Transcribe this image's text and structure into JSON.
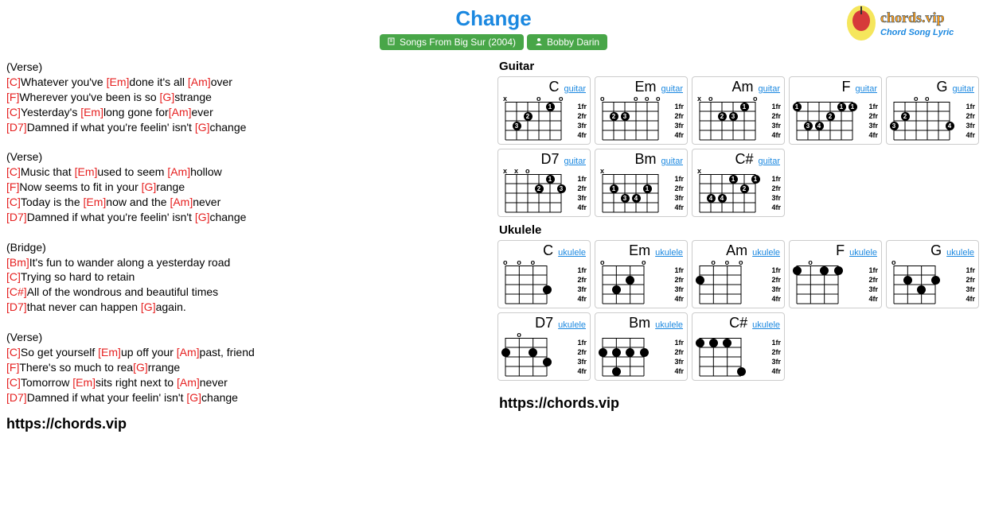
{
  "header": {
    "title": "Change",
    "album_tag": "Songs From Big Sur (2004)",
    "artist_tag": "Bobby Darin",
    "logo_main": "chords.vip",
    "logo_sub": "Chord Song Lyric"
  },
  "lyrics": [
    {
      "type": "text",
      "v": "(Verse)"
    },
    {
      "type": "line",
      "parts": [
        [
          "[C]",
          "Whatever you've "
        ],
        [
          "[Em]",
          "done it's all "
        ],
        [
          "[Am]",
          "over"
        ]
      ]
    },
    {
      "type": "line",
      "parts": [
        [
          "[F]",
          "Wherever you've been is so "
        ],
        [
          "[G]",
          "strange"
        ]
      ]
    },
    {
      "type": "line",
      "parts": [
        [
          "[C]",
          "Yesterday's "
        ],
        [
          "[Em]",
          "long gone for"
        ],
        [
          "[Am]",
          "ever"
        ]
      ]
    },
    {
      "type": "line",
      "parts": [
        [
          "[D7]",
          "Damned if what you're feelin' isn't "
        ],
        [
          "[G]",
          "change"
        ]
      ]
    },
    {
      "type": "blank"
    },
    {
      "type": "text",
      "v": "(Verse)"
    },
    {
      "type": "line",
      "parts": [
        [
          "[C]",
          "Music that "
        ],
        [
          "[Em]",
          "used to seem "
        ],
        [
          "[Am]",
          "hollow"
        ]
      ]
    },
    {
      "type": "line",
      "parts": [
        [
          "[F]",
          "Now seems to fit in your "
        ],
        [
          "[G]",
          "range"
        ]
      ]
    },
    {
      "type": "line",
      "parts": [
        [
          "[C]",
          "Today is the "
        ],
        [
          "[Em]",
          "now and the "
        ],
        [
          "[Am]",
          "never"
        ]
      ]
    },
    {
      "type": "line",
      "parts": [
        [
          "[D7]",
          "Damned if what you're feelin' isn't "
        ],
        [
          "[G]",
          "change"
        ]
      ]
    },
    {
      "type": "blank"
    },
    {
      "type": "text",
      "v": "(Bridge)"
    },
    {
      "type": "line",
      "parts": [
        [
          "[Bm]",
          "It's fun to wander along a yesterday road"
        ]
      ]
    },
    {
      "type": "line",
      "parts": [
        [
          "[C]",
          "Trying so hard to retain"
        ]
      ]
    },
    {
      "type": "line",
      "parts": [
        [
          "[C#]",
          "All of the wondrous and beautiful times"
        ]
      ]
    },
    {
      "type": "line",
      "parts": [
        [
          "[D7]",
          "that never can happen "
        ],
        [
          "[G]",
          "again."
        ]
      ]
    },
    {
      "type": "blank"
    },
    {
      "type": "text",
      "v": "(Verse)"
    },
    {
      "type": "line",
      "parts": [
        [
          "[C]",
          "So get yourself "
        ],
        [
          "[Em]",
          "up off your "
        ],
        [
          "[Am]",
          "past, friend"
        ]
      ]
    },
    {
      "type": "line",
      "parts": [
        [
          "[F]",
          "There's so much to rea"
        ],
        [
          "[G]",
          "rrange"
        ]
      ]
    },
    {
      "type": "line",
      "parts": [
        [
          "[C]",
          "Tomorrow "
        ],
        [
          "[Em]",
          "sits right next to "
        ],
        [
          "[Am]",
          "never"
        ]
      ]
    },
    {
      "type": "line",
      "parts": [
        [
          "[D7]",
          "Damned if what your feelin' isn't "
        ],
        [
          "[G]",
          "change"
        ]
      ]
    }
  ],
  "footer": "https://chords.vip",
  "fret_labels": [
    "1fr",
    "2fr",
    "3fr",
    "4fr"
  ],
  "sections": [
    {
      "title": "Guitar",
      "instr_label": "guitar",
      "strings": 6,
      "chords": [
        {
          "name": "C",
          "markers": [
            "x",
            "",
            "",
            "o",
            "",
            "o"
          ],
          "dots": [
            [
              1,
              0,
              "1"
            ],
            [
              3,
              1,
              "2"
            ],
            [
              4,
              2,
              "3"
            ]
          ]
        },
        {
          "name": "Em",
          "markers": [
            "o",
            "",
            "",
            "o",
            "o",
            "o"
          ],
          "dots": [
            [
              4,
              1,
              "2"
            ],
            [
              3,
              1,
              "3"
            ]
          ]
        },
        {
          "name": "Am",
          "markers": [
            "x",
            "o",
            "",
            "",
            "",
            "o"
          ],
          "dots": [
            [
              1,
              0,
              "1"
            ],
            [
              3,
              1,
              "2"
            ],
            [
              2,
              1,
              "3"
            ]
          ]
        },
        {
          "name": "F",
          "markers": [
            "",
            "",
            "",
            "",
            "",
            ""
          ],
          "dots": [
            [
              5,
              0,
              "1"
            ],
            [
              1,
              0,
              "1"
            ],
            [
              0,
              0,
              "1"
            ],
            [
              2,
              1,
              "2"
            ],
            [
              4,
              2,
              "3"
            ],
            [
              3,
              2,
              "4"
            ]
          ]
        },
        {
          "name": "G",
          "markers": [
            "",
            "",
            "o",
            "o",
            "",
            ""
          ],
          "dots": [
            [
              4,
              1,
              "2"
            ],
            [
              5,
              2,
              "3"
            ],
            [
              0,
              2,
              "4"
            ]
          ]
        },
        {
          "name": "D7",
          "markers": [
            "x",
            "x",
            "o",
            "",
            "",
            ""
          ],
          "dots": [
            [
              1,
              0,
              "1"
            ],
            [
              2,
              1,
              "2"
            ],
            [
              0,
              1,
              "3"
            ]
          ]
        },
        {
          "name": "Bm",
          "markers": [
            "x",
            "",
            "",
            "",
            "",
            ""
          ],
          "dots": [
            [
              4,
              1,
              "1"
            ],
            [
              1,
              1,
              "1"
            ],
            [
              3,
              2,
              "3"
            ],
            [
              2,
              2,
              "4"
            ]
          ]
        },
        {
          "name": "C#",
          "markers": [
            "x",
            "",
            "",
            "",
            "",
            ""
          ],
          "dots": [
            [
              2,
              0,
              "1"
            ],
            [
              0,
              0,
              "1"
            ],
            [
              1,
              1,
              "2"
            ],
            [
              3,
              2,
              "4"
            ],
            [
              4,
              2,
              "4"
            ]
          ]
        }
      ]
    },
    {
      "title": "Ukulele",
      "instr_label": "ukulele",
      "strings": 4,
      "chords": [
        {
          "name": "C",
          "markers": [
            "o",
            "o",
            "o",
            ""
          ],
          "dots": [
            [
              0,
              2,
              ""
            ]
          ]
        },
        {
          "name": "Em",
          "markers": [
            "o",
            "",
            "",
            "o"
          ],
          "dots": [
            [
              1,
              1,
              ""
            ],
            [
              2,
              2,
              ""
            ]
          ]
        },
        {
          "name": "Am",
          "markers": [
            "",
            "o",
            "o",
            "o"
          ],
          "dots": [
            [
              3,
              1,
              ""
            ]
          ]
        },
        {
          "name": "F",
          "markers": [
            "",
            "o",
            "",
            ""
          ],
          "dots": [
            [
              3,
              0,
              ""
            ],
            [
              1,
              0,
              ""
            ],
            [
              0,
              0,
              ""
            ]
          ]
        },
        {
          "name": "G",
          "markers": [
            "o",
            "",
            "",
            ""
          ],
          "dots": [
            [
              2,
              1,
              ""
            ],
            [
              0,
              1,
              ""
            ],
            [
              1,
              2,
              ""
            ]
          ]
        },
        {
          "name": "D7",
          "markers": [
            "",
            "o",
            "",
            ""
          ],
          "dots": [
            [
              3,
              1,
              ""
            ],
            [
              1,
              1,
              ""
            ],
            [
              0,
              2,
              ""
            ]
          ]
        },
        {
          "name": "Bm",
          "markers": [
            "",
            "",
            "",
            ""
          ],
          "dots": [
            [
              3,
              1,
              ""
            ],
            [
              2,
              1,
              ""
            ],
            [
              1,
              1,
              ""
            ],
            [
              0,
              1,
              ""
            ],
            [
              2,
              3,
              ""
            ]
          ]
        },
        {
          "name": "C#",
          "markers": [
            "",
            "",
            "",
            ""
          ],
          "dots": [
            [
              3,
              0,
              ""
            ],
            [
              2,
              0,
              ""
            ],
            [
              1,
              0,
              ""
            ],
            [
              0,
              3,
              ""
            ]
          ]
        }
      ]
    }
  ]
}
